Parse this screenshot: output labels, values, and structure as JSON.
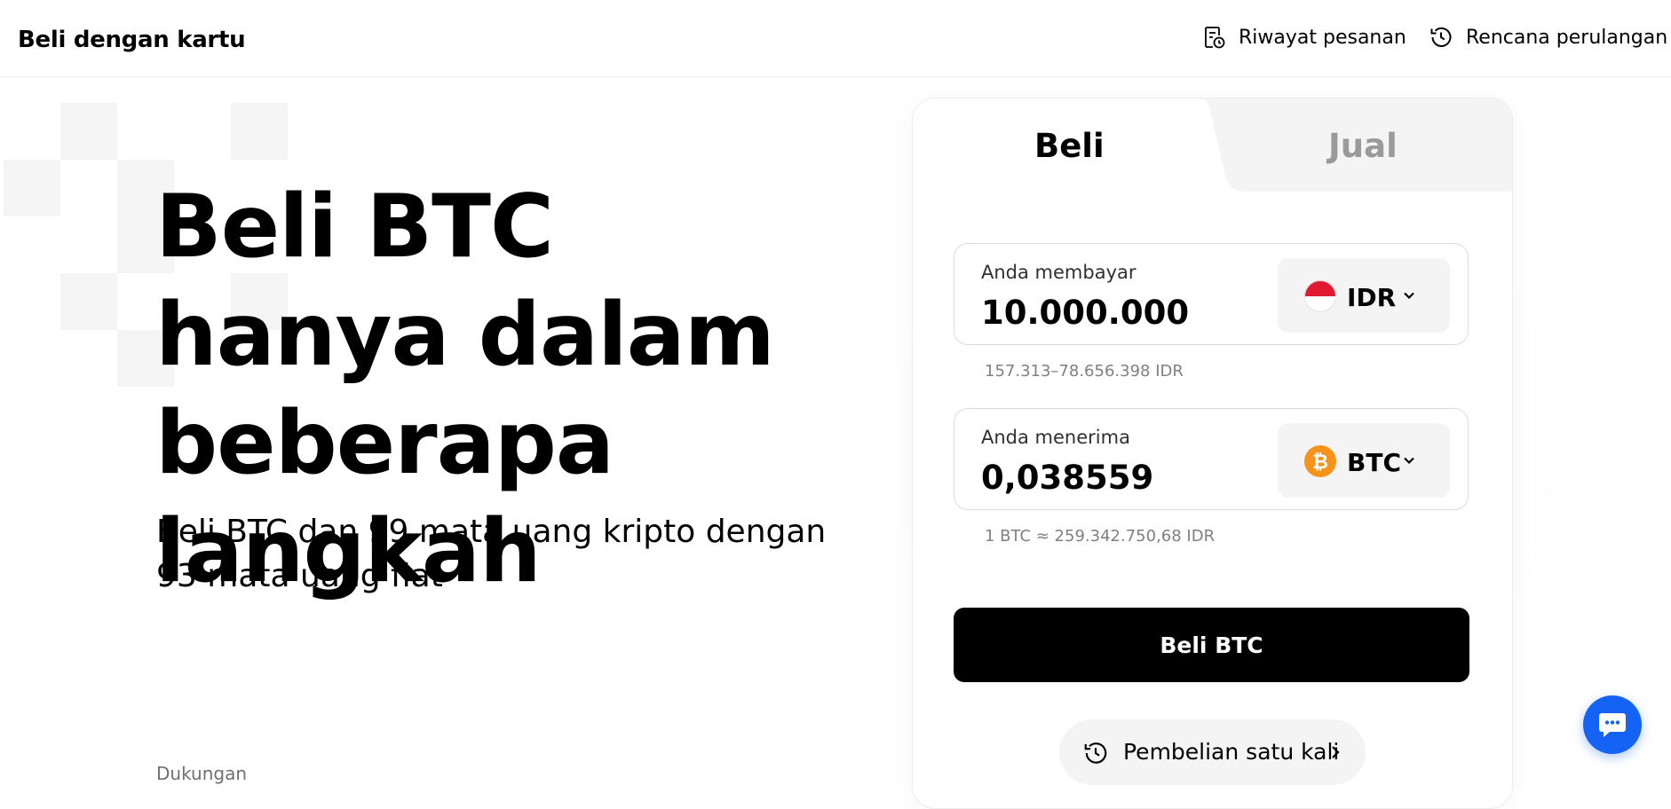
{
  "header": {
    "title": "Beli dengan kartu",
    "nav": [
      {
        "label": "Riwayat pesanan",
        "icon": "order-history-icon"
      },
      {
        "label": "Rencana perulangan",
        "icon": "history-clock-icon"
      }
    ]
  },
  "hero": {
    "title": "Beli BTC hanya dalam beberapa langkah",
    "subtitle": "Beli BTC dan 99 mata uang kripto dengan 93 mata uang fiat",
    "support_label": "Dukungan"
  },
  "trade_card": {
    "tabs": [
      {
        "label": "Beli",
        "active": true
      },
      {
        "label": "Jual",
        "active": false
      }
    ],
    "pay": {
      "label": "Anda membayar",
      "value": "10.000.000",
      "currency": "IDR",
      "currency_icon": "indonesia-flag-icon",
      "hint": "157.313–78.656.398 IDR"
    },
    "receive": {
      "label": "Anda menerima",
      "value": "0,038559",
      "currency": "BTC",
      "currency_icon": "bitcoin-icon",
      "hint": "1 BTC ≈ 259.342.750,68 IDR"
    },
    "cta_label": "Beli BTC",
    "mode": {
      "label": "Pembelian satu kali",
      "icon": "history-clock-icon"
    }
  },
  "chat": {
    "icon": "chat-bubble-icon"
  },
  "colors": {
    "accent": "#000000",
    "chat_button": "#1463f5",
    "bitcoin": "#f7931a",
    "flag_red": "#e11931",
    "muted_text": "#808080"
  }
}
